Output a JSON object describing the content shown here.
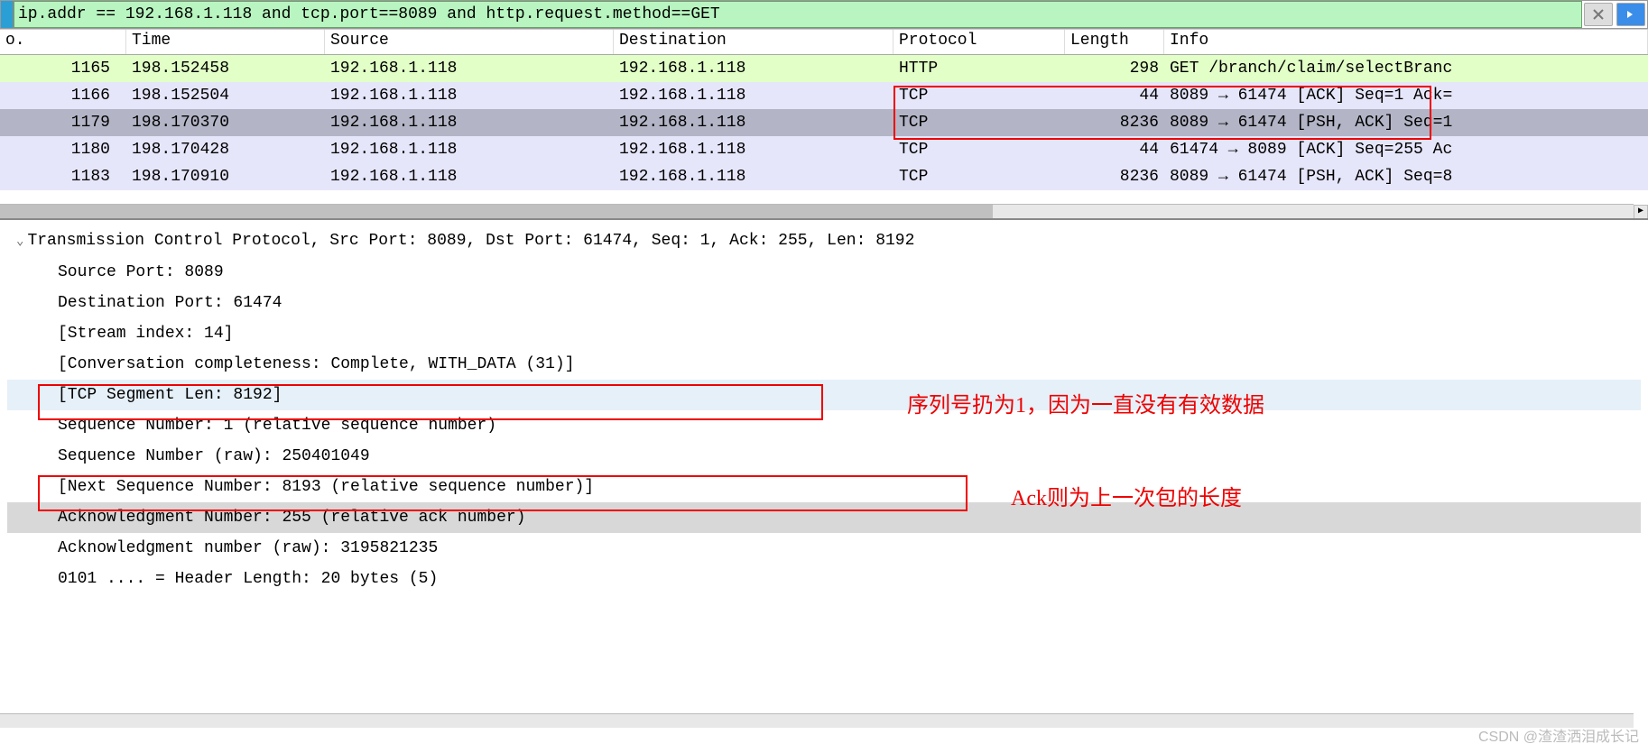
{
  "filter": {
    "value": "ip.addr == 192.168.1.118 and tcp.port==8089 and http.request.method==GET"
  },
  "columns": {
    "no": "o.",
    "time": "Time",
    "source": "Source",
    "destination": "Destination",
    "protocol": "Protocol",
    "length": "Length",
    "info": "Info"
  },
  "rows": [
    {
      "no": "1165",
      "time": "198.152458",
      "src": "192.168.1.118",
      "dst": "192.168.1.118",
      "proto": "HTTP",
      "len": "298",
      "info": "GET /branch/claim/selectBranc",
      "cls": "row-green"
    },
    {
      "no": "1166",
      "time": "198.152504",
      "src": "192.168.1.118",
      "dst": "192.168.1.118",
      "proto": "TCP",
      "len": "44",
      "info": "8089 → 61474 [ACK] Seq=1 Ack=",
      "cls": "row-lav"
    },
    {
      "no": "1179",
      "time": "198.170370",
      "src": "192.168.1.118",
      "dst": "192.168.1.118",
      "proto": "TCP",
      "len": "8236",
      "info": "8089 → 61474 [PSH, ACK] Seq=1",
      "cls": "row-sel"
    },
    {
      "no": "1180",
      "time": "198.170428",
      "src": "192.168.1.118",
      "dst": "192.168.1.118",
      "proto": "TCP",
      "len": "44",
      "info": "61474 → 8089 [ACK] Seq=255 Ac",
      "cls": "row-lav"
    },
    {
      "no": "1183",
      "time": "198.170910",
      "src": "192.168.1.118",
      "dst": "192.168.1.118",
      "proto": "TCP",
      "len": "8236",
      "info": "8089 → 61474 [PSH, ACK] Seq=8",
      "cls": "row-lav"
    }
  ],
  "detail": {
    "root": "Transmission Control Protocol, Src Port: 8089, Dst Port: 61474, Seq: 1, Ack: 255, Len: 8192",
    "src_port": "Source Port: 8089",
    "dst_port": "Destination Port: 61474",
    "stream": "[Stream index: 14]",
    "conv": "[Conversation completeness: Complete, WITH_DATA (31)]",
    "tcp_seg": "[TCP Segment Len: 8192]",
    "seq": "Sequence Number: 1    (relative sequence number)",
    "seq_raw": "Sequence Number (raw): 250401049",
    "next_seq": "[Next Sequence Number: 8193    (relative sequence number)]",
    "ack": "Acknowledgment Number: 255    (relative ack number)",
    "ack_raw": "Acknowledgment number (raw): 3195821235",
    "hdr_len": "0101 .... = Header Length: 20 bytes (5)"
  },
  "annotations": {
    "a1": "序列号扔为1，因为一直没有有效数据",
    "a2": "Ack则为上一次包的长度"
  },
  "watermark": "CSDN @渣渣洒泪成长记"
}
